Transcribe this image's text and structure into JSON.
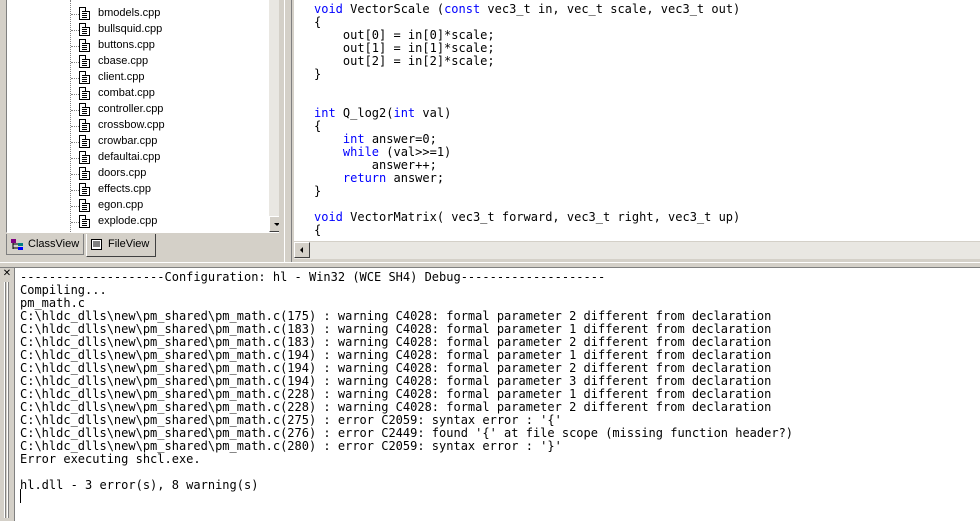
{
  "workspace": {
    "files": [
      "bmodels.cpp",
      "bullsquid.cpp",
      "buttons.cpp",
      "cbase.cpp",
      "client.cpp",
      "combat.cpp",
      "controller.cpp",
      "crossbow.cpp",
      "crowbar.cpp",
      "defaultai.cpp",
      "doors.cpp",
      "effects.cpp",
      "egon.cpp",
      "explode.cpp"
    ],
    "tabs": [
      {
        "label": "ClassView",
        "icon": "classview-icon",
        "active": false
      },
      {
        "label": "FileView",
        "icon": "fileview-icon",
        "active": true
      }
    ]
  },
  "editor": {
    "lines": [
      [
        [
          "kw",
          "void"
        ],
        [
          "t",
          " VectorScale ("
        ],
        [
          "kw",
          "const"
        ],
        [
          "t",
          " vec3_t in, vec_t scale, vec3_t out)"
        ]
      ],
      [
        [
          "t",
          "{"
        ]
      ],
      [
        [
          "t",
          "    out[0] = in[0]*scale;"
        ]
      ],
      [
        [
          "t",
          "    out[1] = in[1]*scale;"
        ]
      ],
      [
        [
          "t",
          "    out[2] = in[2]*scale;"
        ]
      ],
      [
        [
          "t",
          "}"
        ]
      ],
      [
        [
          "t",
          ""
        ]
      ],
      [
        [
          "t",
          ""
        ]
      ],
      [
        [
          "kw",
          "int"
        ],
        [
          "t",
          " Q_log2("
        ],
        [
          "kw",
          "int"
        ],
        [
          "t",
          " val)"
        ]
      ],
      [
        [
          "t",
          "{"
        ]
      ],
      [
        [
          "t",
          "    "
        ],
        [
          "kw",
          "int"
        ],
        [
          "t",
          " answer=0;"
        ]
      ],
      [
        [
          "t",
          "    "
        ],
        [
          "kw",
          "while"
        ],
        [
          "t",
          " (val>>=1)"
        ]
      ],
      [
        [
          "t",
          "        answer++;"
        ]
      ],
      [
        [
          "t",
          "    "
        ],
        [
          "kw",
          "return"
        ],
        [
          "t",
          " answer;"
        ]
      ],
      [
        [
          "t",
          "}"
        ]
      ],
      [
        [
          "t",
          ""
        ]
      ],
      [
        [
          "kw",
          "void"
        ],
        [
          "t",
          " VectorMatrix( vec3_t forward, vec3_t right, vec3_t up)"
        ]
      ],
      [
        [
          "t",
          "{"
        ]
      ]
    ]
  },
  "output": {
    "lines": [
      "--------------------Configuration: hl - Win32 (WCE SH4) Debug--------------------",
      "Compiling...",
      "pm_math.c",
      "C:\\hldc_dlls\\new\\pm_shared\\pm_math.c(175) : warning C4028: formal parameter 2 different from declaration",
      "C:\\hldc_dlls\\new\\pm_shared\\pm_math.c(183) : warning C4028: formal parameter 1 different from declaration",
      "C:\\hldc_dlls\\new\\pm_shared\\pm_math.c(183) : warning C4028: formal parameter 2 different from declaration",
      "C:\\hldc_dlls\\new\\pm_shared\\pm_math.c(194) : warning C4028: formal parameter 1 different from declaration",
      "C:\\hldc_dlls\\new\\pm_shared\\pm_math.c(194) : warning C4028: formal parameter 2 different from declaration",
      "C:\\hldc_dlls\\new\\pm_shared\\pm_math.c(194) : warning C4028: formal parameter 3 different from declaration",
      "C:\\hldc_dlls\\new\\pm_shared\\pm_math.c(228) : warning C4028: formal parameter 1 different from declaration",
      "C:\\hldc_dlls\\new\\pm_shared\\pm_math.c(228) : warning C4028: formal parameter 2 different from declaration",
      "C:\\hldc_dlls\\new\\pm_shared\\pm_math.c(275) : error C2059: syntax error : '{'",
      "C:\\hldc_dlls\\new\\pm_shared\\pm_math.c(276) : error C2449: found '{' at file scope (missing function header?)",
      "C:\\hldc_dlls\\new\\pm_shared\\pm_math.c(280) : error C2059: syntax error : '}'",
      "Error executing shcl.exe.",
      "",
      "hl.dll - 3 error(s), 8 warning(s)"
    ]
  },
  "colors": {
    "keyword": "#0000ff",
    "chrome": "#d4d0c8",
    "text": "#000000"
  }
}
